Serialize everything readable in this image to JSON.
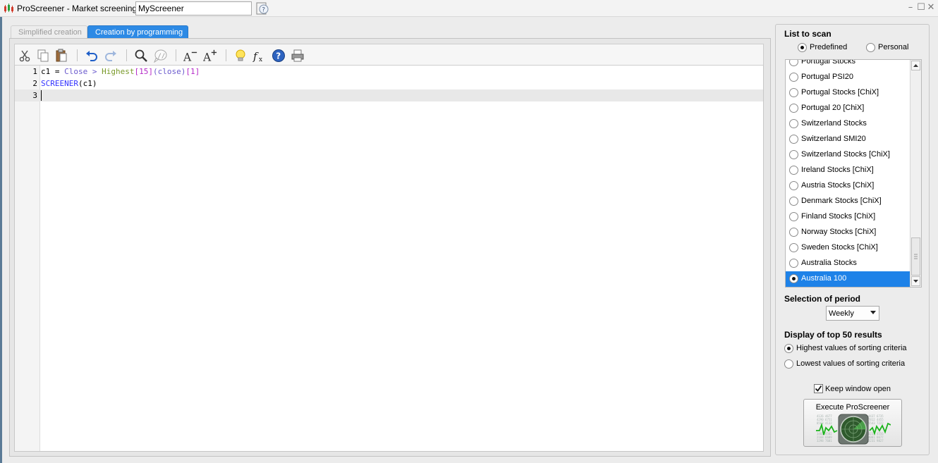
{
  "window": {
    "title": "ProScreener - Market screening  -",
    "screener_name": "MyScreener"
  },
  "tabs": [
    {
      "label": "Simplified creation",
      "active": false
    },
    {
      "label": "Creation by programming",
      "active": true
    }
  ],
  "toolbar": {
    "icons": [
      "cut-icon",
      "copy-icon",
      "paste-icon",
      "undo-icon",
      "redo-icon",
      "search-icon",
      "comment-icon",
      "font-decrease-icon",
      "font-increase-icon",
      "idea-icon",
      "function-icon",
      "help-icon",
      "print-icon"
    ]
  },
  "editor": {
    "lines": [
      {
        "number": "1",
        "text": "c1 = Close > Highest[15](close)[1]"
      },
      {
        "number": "2",
        "text": "SCREENER(c1)"
      },
      {
        "number": "3",
        "text": ""
      }
    ]
  },
  "list_to_scan": {
    "title": "List to scan",
    "mode_options": [
      {
        "label": "Predefined",
        "selected": true
      },
      {
        "label": "Personal",
        "selected": false
      }
    ],
    "items": [
      {
        "label": "Portugal Stocks",
        "selected": false
      },
      {
        "label": "Portugal PSI20",
        "selected": false
      },
      {
        "label": "Portugal Stocks [ChiX]",
        "selected": false
      },
      {
        "label": "Portugal 20 [ChiX]",
        "selected": false
      },
      {
        "label": "Switzerland Stocks",
        "selected": false
      },
      {
        "label": "Switzerland SMI20",
        "selected": false
      },
      {
        "label": "Switzerland Stocks [ChiX]",
        "selected": false
      },
      {
        "label": "Ireland Stocks [ChiX]",
        "selected": false
      },
      {
        "label": "Austria Stocks [ChiX]",
        "selected": false
      },
      {
        "label": "Denmark Stocks [ChiX]",
        "selected": false
      },
      {
        "label": "Finland Stocks [ChiX]",
        "selected": false
      },
      {
        "label": "Norway Stocks [ChiX]",
        "selected": false
      },
      {
        "label": "Sweden Stocks [ChiX]",
        "selected": false
      },
      {
        "label": "Australia Stocks",
        "selected": false
      },
      {
        "label": "Australia 100",
        "selected": true
      }
    ]
  },
  "period": {
    "title": "Selection of period",
    "selected": "Weekly"
  },
  "results": {
    "title": "Display of top 50 results",
    "options": [
      {
        "label": "Highest values of sorting criteria",
        "selected": true
      },
      {
        "label": "Lowest values of sorting criteria",
        "selected": false
      }
    ]
  },
  "keep_open": {
    "label": "Keep window open",
    "checked": true
  },
  "execute": {
    "label": "Execute ProScreener"
  },
  "colors": {
    "accent": "#2d8ae5",
    "selection": "#1e82e8",
    "keyword": "#6a5acd",
    "function": "#7a9a2a",
    "number": "#b42ac8"
  }
}
